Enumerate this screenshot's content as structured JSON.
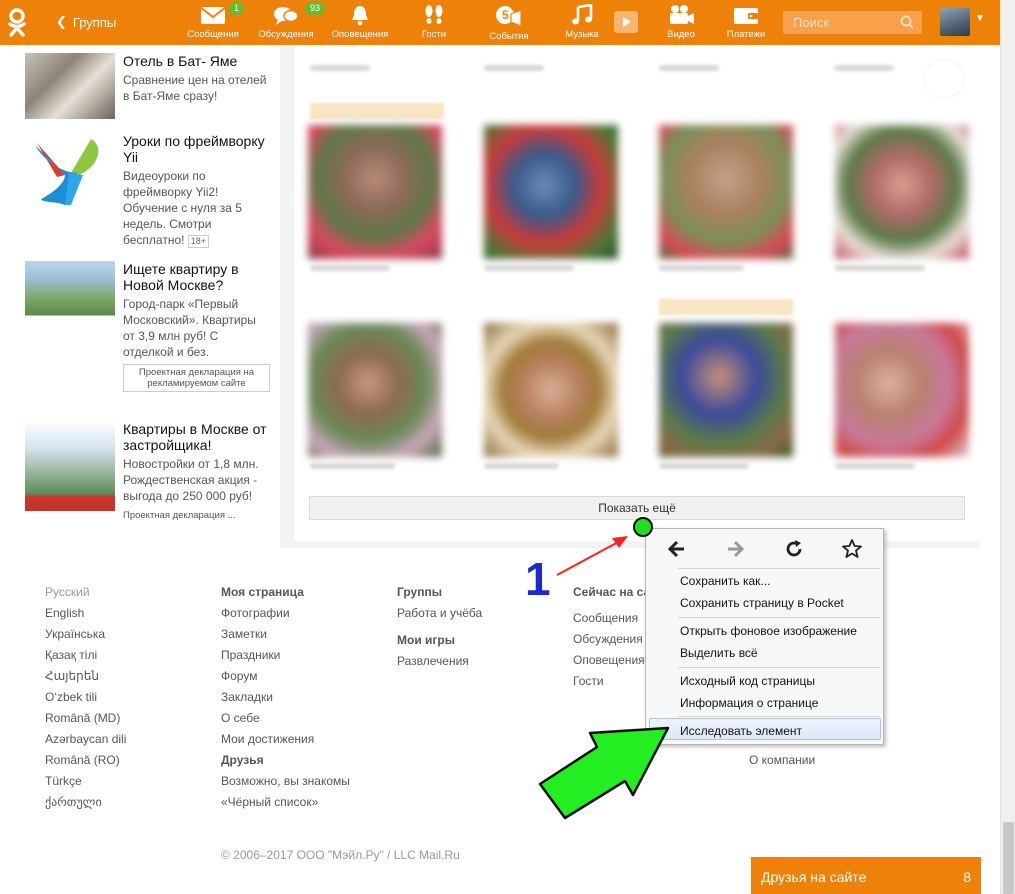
{
  "header": {
    "back_label": "Группы",
    "nav": [
      {
        "label": "Сообщения",
        "icon": "envelope-icon",
        "badge": "1"
      },
      {
        "label": "Обсуждения",
        "icon": "chat-bubbles-icon",
        "badge": "93"
      },
      {
        "label": "Оповещения",
        "icon": "bell-icon",
        "badge": ""
      },
      {
        "label": "Гости",
        "icon": "footprints-icon",
        "badge": ""
      },
      {
        "label": "События",
        "icon": "events-icon",
        "badge": "5"
      },
      {
        "label": "Музыка",
        "icon": "music-note-icon",
        "badge": ""
      },
      {
        "label": "Видео",
        "icon": "video-camera-icon",
        "badge": ""
      },
      {
        "label": "Платежи",
        "icon": "wallet-icon",
        "badge": ""
      }
    ],
    "search_placeholder": "Поиск"
  },
  "ads": [
    {
      "title": "Отель в Бат- Яме",
      "desc": "Сравнение цен на отелей в Бат-Яме сразу!"
    },
    {
      "title": "Уроки по фреймворку Yii",
      "desc": "Видеоуроки по фреймворку Yii2! Обучение с нуля за 5 недель. Смотри бесплатно!",
      "age": "18+"
    },
    {
      "title": "Ищете квартиру в Новой Москве?",
      "desc": "Город-парк «Первый Московский». Квартиры от 3,9 млн руб! С отделкой и без.",
      "declaration": "Проектная декларация на рекламируемом сайте"
    },
    {
      "title": "Квартиры в Москве от застройщика!",
      "desc": "Новостройки от 1,8 млн. Рождественская акция - выгода до 250 000 руб!",
      "declaration": "Проектная декларация ..."
    }
  ],
  "photos": {
    "show_more_label": "Показать ещё"
  },
  "footer": {
    "languages": [
      "Русский",
      "English",
      "Українська",
      "Қазақ тілі",
      "Հայերեն",
      "O‘zbek tili",
      "Română (MD)",
      "Azərbaycan dili",
      "Română (RO)",
      "Türkçe",
      "ქართული"
    ],
    "my_page": {
      "heading": "Моя страница",
      "items": [
        "Фотографии",
        "Заметки",
        "Праздники",
        "Форум",
        "Закладки",
        "О себе",
        "Мои достижения"
      ]
    },
    "friends": {
      "heading": "Друзья",
      "items": [
        "Возможно, вы знакомы",
        "«Чёрный список»"
      ]
    },
    "groups": {
      "heading": "Группы",
      "items": [
        "Работа и учёба"
      ]
    },
    "games": {
      "heading": "Мои игры",
      "items": [
        "Развлечения"
      ]
    },
    "now": {
      "heading": "Сейчас на са",
      "items": [
        "Сообщения",
        "Обсуждения",
        "Оповещения",
        "Гости"
      ]
    },
    "about": "О компании",
    "copyright": "© 2006–2017 ООО \"Мэйл.Ру\" / LLC Mail.Ru"
  },
  "friends_online": {
    "label": "Друзья на сайте",
    "count": "8"
  },
  "context_menu": {
    "items": [
      "Сохранить как...",
      "Сохранить страницу в Pocket",
      "Открыть фоновое изображение",
      "Выделить всё",
      "Исходный код страницы",
      "Информация о странице",
      "Исследовать элемент"
    ]
  },
  "annotation": {
    "number": "1",
    "arrow_color": "#ff2020",
    "big_arrow_color": "#22dd22"
  },
  "colors": {
    "brand": "#ee8208",
    "badge": "#6ab82d"
  }
}
